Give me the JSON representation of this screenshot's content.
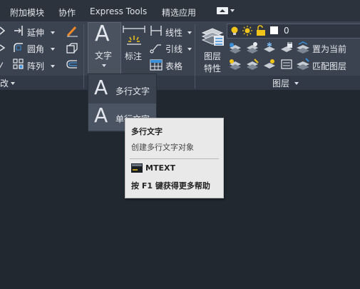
{
  "tabs": [
    "附加模块",
    "协作",
    "Express Tools",
    "精选应用"
  ],
  "modify_panel": {
    "items": [
      "延伸",
      "圆角",
      "阵列"
    ],
    "footer_fragment": "改"
  },
  "annotation_panel": {
    "text_button": "文字",
    "dim_button": "标注",
    "items": [
      "线性",
      "引线",
      "表格"
    ]
  },
  "layers_panel": {
    "layer_props_line1": "图层",
    "layer_props_line2": "特性",
    "current_layer": "0",
    "actions": [
      "置为当前",
      "匹配图层"
    ],
    "footer": "图层"
  },
  "dropdown": {
    "items": [
      "多行文字",
      "单行文字"
    ]
  },
  "tooltip": {
    "title": "多行文字",
    "description": "创建多行文字对象",
    "command": "MTEXT",
    "help": "按 F1 键获得更多帮助"
  },
  "colors": {
    "background": "#212830",
    "ribbon": "#3b4350",
    "accent_yellow": "#f0c419",
    "accent_blue": "#3a8fd8"
  }
}
